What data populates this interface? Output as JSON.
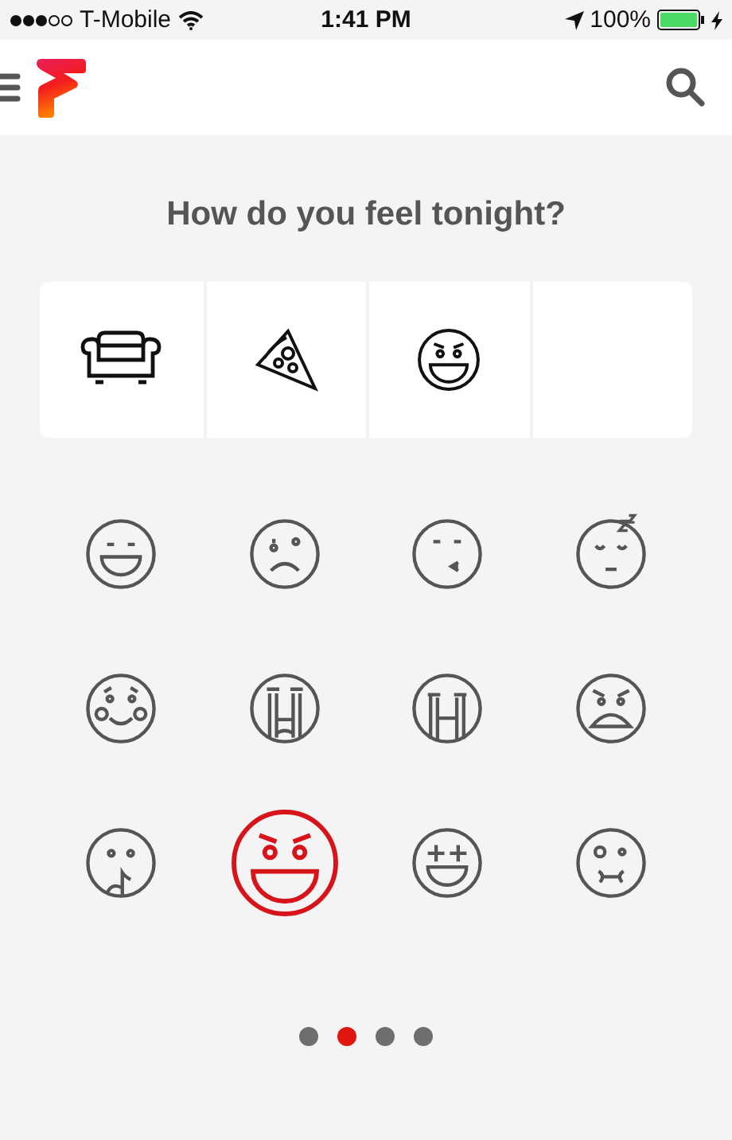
{
  "status_bar": {
    "carrier": "T-Mobile",
    "time": "1:41 PM",
    "battery": "100%"
  },
  "title": "How do you feel tonight?",
  "slots": [
    {
      "kind": "sofa"
    },
    {
      "kind": "pizza"
    },
    {
      "kind": "grin"
    },
    {
      "kind": "empty"
    }
  ],
  "emojis": [
    {
      "kind": "laugh",
      "selected": false
    },
    {
      "kind": "cry",
      "selected": false
    },
    {
      "kind": "kiss",
      "selected": false
    },
    {
      "kind": "sleep",
      "selected": false
    },
    {
      "kind": "blush",
      "selected": false
    },
    {
      "kind": "sob",
      "selected": false
    },
    {
      "kind": "weep",
      "selected": false
    },
    {
      "kind": "angry",
      "selected": false
    },
    {
      "kind": "shush",
      "selected": false
    },
    {
      "kind": "evil",
      "selected": true
    },
    {
      "kind": "stars",
      "selected": false
    },
    {
      "kind": "sick",
      "selected": false
    }
  ],
  "pages": [
    {
      "selected": false
    },
    {
      "selected": true
    },
    {
      "selected": false
    },
    {
      "selected": false
    }
  ]
}
